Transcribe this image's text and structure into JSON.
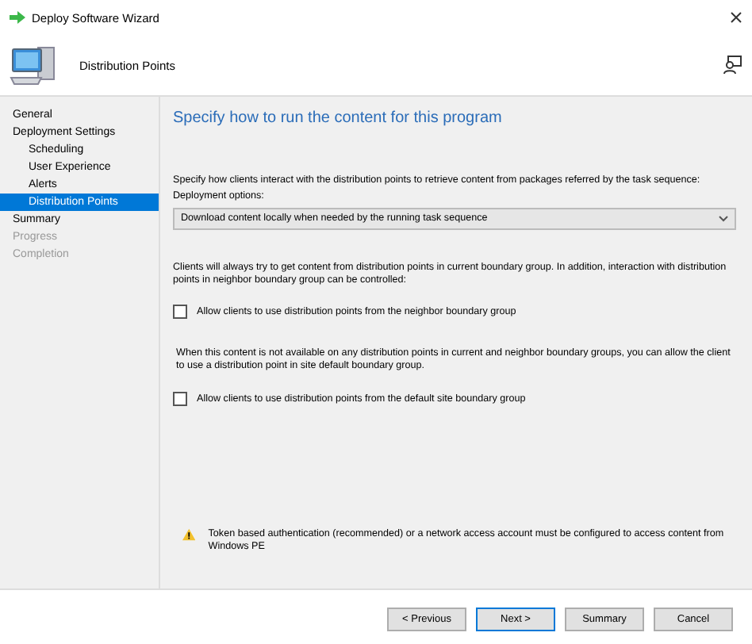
{
  "window": {
    "title": "Deploy Software Wizard"
  },
  "header": {
    "title": "Distribution Points"
  },
  "sidebar": {
    "items": [
      {
        "label": "General",
        "selected": false,
        "disabled": false
      },
      {
        "label": "Deployment Settings",
        "selected": false,
        "disabled": false,
        "children": [
          {
            "label": "Scheduling",
            "selected": false,
            "disabled": false
          },
          {
            "label": "User Experience",
            "selected": false,
            "disabled": false
          },
          {
            "label": "Alerts",
            "selected": false,
            "disabled": false
          },
          {
            "label": "Distribution Points",
            "selected": true,
            "disabled": false
          }
        ]
      },
      {
        "label": "Summary",
        "selected": false,
        "disabled": false
      },
      {
        "label": "Progress",
        "selected": false,
        "disabled": true
      },
      {
        "label": "Completion",
        "selected": false,
        "disabled": true
      }
    ]
  },
  "content": {
    "heading": "Specify how to run the content for this program",
    "intro": "Specify how clients interact with the distribution points to retrieve content from packages referred by the task sequence:",
    "options_label": "Deployment options:",
    "options_value": "Download content locally when needed by the running task sequence",
    "neighbor_text": "Clients will always try to get content from distribution points in current boundary group. In addition, interaction with distribution points in neighbor boundary group can be controlled:",
    "neighbor_checkbox": {
      "label": "Allow clients to use distribution points from the neighbor boundary group",
      "checked": false
    },
    "default_text": "When this content is not available on any distribution points in current and neighbor boundary groups, you can allow the client to use a distribution point in site default boundary group.",
    "default_checkbox": {
      "label": "Allow clients to use distribution points from the default site boundary group",
      "checked": false
    },
    "warning": "Token based authentication (recommended) or a network access account must be configured to access content from Windows PE"
  },
  "buttons": [
    {
      "label": "< Previous",
      "default": false
    },
    {
      "label": "Next >",
      "default": true
    },
    {
      "label": "Summary",
      "default": false
    },
    {
      "label": "Cancel",
      "default": false
    }
  ]
}
